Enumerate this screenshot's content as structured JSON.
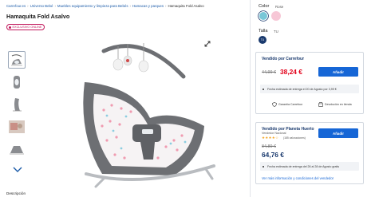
{
  "breadcrumb": {
    "items": [
      "Carrefour.es",
      "Universo Bebé",
      "Muebles equipamiento y limpieza para Bebés",
      "Hamacas y parques"
    ],
    "current": "Hamaquita Fold Asalvo"
  },
  "product": {
    "title": "Hamaquita Fold Asalvo",
    "badge": "EXCLUSIVO ONLINE"
  },
  "description_label": "Descripción",
  "options": {
    "color_label": "Color",
    "color_value": "Rose",
    "swatches": [
      "#78c7d8",
      "#f7c7d6"
    ],
    "size_label": "Talla",
    "size_value": "TU",
    "size_chip": "TU"
  },
  "offer1": {
    "seller": "Vendido por Carrefour",
    "old_price": "44,99 €",
    "new_price": "38,24 €",
    "button": "Añadir",
    "delivery": "Fecha estimada de entrega el 20 de Agosto por 3,99 €",
    "perk1": "Garantía Carrefour",
    "perk2": "Devolución en tienda"
  },
  "offer2": {
    "seller": "Vendido por Planeta Huerto",
    "seller_type": "Vendedor Nacional",
    "stars": "★★★★☆",
    "ratings": "(185 valoraciones)",
    "old_price": "84,89 €",
    "new_price": "64,76 €",
    "button": "Añadir",
    "delivery": "Fecha estimada de entrega del 26 al 28 de Agosto gratis",
    "more": "Ver más información y condiciones del vendedor"
  },
  "colors": {
    "accent": "#1666d6",
    "price_red": "#e2001a",
    "navy": "#1a3a6e",
    "exclusive": "#c2185b"
  }
}
